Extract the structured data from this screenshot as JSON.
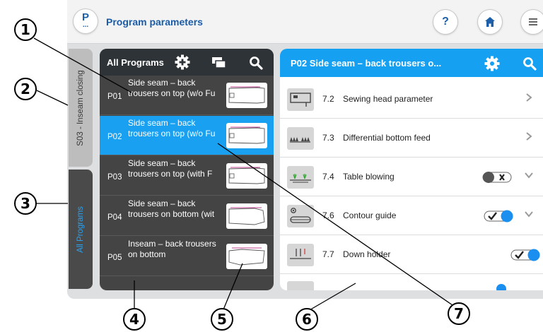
{
  "topbar": {
    "logo_letter": "P",
    "logo_dots": "...",
    "title": "Program parameters",
    "help_label": "?"
  },
  "side_tabs": {
    "station": "S03 - Inseam closing",
    "all_programs": "All Programs"
  },
  "programs_panel": {
    "title": "All Programs",
    "items": [
      {
        "num": "P01",
        "name": "Side seam – back trousers on top (w/o Fu",
        "selected": false
      },
      {
        "num": "P02",
        "name": "Side seam – back trousers on top (w/o Fu",
        "selected": true
      },
      {
        "num": "P03",
        "name": "Side seam – back trousers on top (with F",
        "selected": false
      },
      {
        "num": "P04",
        "name": "Side seam – back trousers on bottom (wit",
        "selected": false
      },
      {
        "num": "P05",
        "name": "Inseam – back trousers on bottom",
        "selected": false
      }
    ]
  },
  "parameters_panel": {
    "title": "P02 Side seam – back trousers o...",
    "rows": [
      {
        "num": "7.2",
        "label": "Sewing head parameter",
        "control": "chevron-right",
        "icon": "sewing-head-icon"
      },
      {
        "num": "7.3",
        "label": "Differential bottom feed",
        "control": "chevron-right",
        "icon": "feed-dog-icon"
      },
      {
        "num": "7.4",
        "label": "Table blowing",
        "control": "toggle-off",
        "icon": "table-blowing-icon"
      },
      {
        "num": "7.6",
        "label": "Contour guide",
        "control": "toggle-on",
        "icon": "contour-guide-icon"
      },
      {
        "num": "7.7",
        "label": "Down holder",
        "control": "toggle-on",
        "icon": "down-holder-icon"
      }
    ]
  },
  "callouts": [
    "1",
    "2",
    "3",
    "4",
    "5",
    "6",
    "7"
  ],
  "colors": {
    "accent": "#1aa0f0",
    "brand": "#1a5ca8",
    "dark_panel": "#444444",
    "panel_header": "#2e3338"
  }
}
